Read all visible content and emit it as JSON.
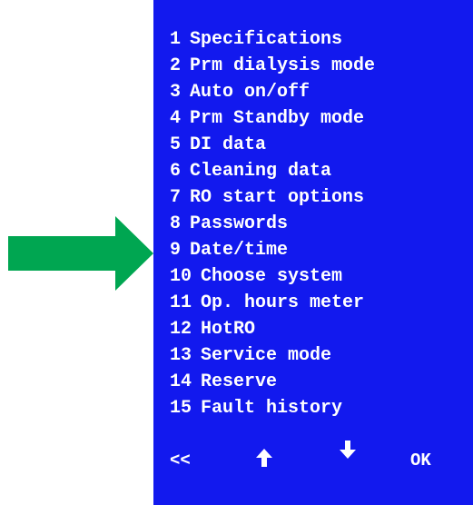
{
  "screen": {
    "background_color": "#1219ee",
    "text_color": "#ffffff"
  },
  "pointer": {
    "icon": "right-arrow-icon",
    "color": "#00a651"
  },
  "menu": {
    "items": [
      {
        "num": "1",
        "label": "Specifications"
      },
      {
        "num": "2",
        "label": "Prm dialysis mode"
      },
      {
        "num": "3",
        "label": "Auto on/off"
      },
      {
        "num": "4",
        "label": "Prm Standby mode"
      },
      {
        "num": "5",
        "label": "DI data"
      },
      {
        "num": "6",
        "label": "Cleaning data"
      },
      {
        "num": "7",
        "label": "RO start options"
      },
      {
        "num": "8",
        "label": "Passwords"
      },
      {
        "num": "9",
        "label": "Date/time"
      },
      {
        "num": "10",
        "label": "Choose system"
      },
      {
        "num": "11",
        "label": "Op. hours meter"
      },
      {
        "num": "12",
        "label": "HotRO"
      },
      {
        "num": "13",
        "label": "Service mode"
      },
      {
        "num": "14",
        "label": "Reserve"
      },
      {
        "num": "15",
        "label": "Fault history"
      }
    ]
  },
  "nav": {
    "back_label": "<<",
    "up_icon": "arrow-up-icon",
    "down_icon": "arrow-down-icon",
    "ok_label": "OK"
  }
}
